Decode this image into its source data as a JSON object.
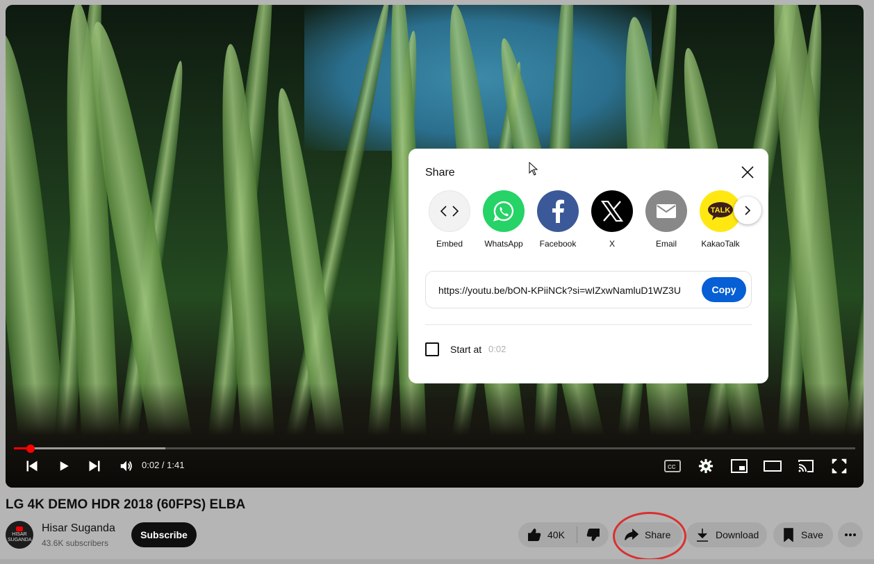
{
  "video": {
    "current_time": "0:02",
    "duration": "1:41",
    "time_display": "0:02 / 1:41",
    "progress_fraction": 0.02
  },
  "share_dialog": {
    "title": "Share",
    "targets": [
      {
        "label": "Embed",
        "icon": "embed-icon",
        "color": "#f2f2f2"
      },
      {
        "label": "WhatsApp",
        "icon": "whatsapp-icon",
        "color": "#25d366"
      },
      {
        "label": "Facebook",
        "icon": "facebook-icon",
        "color": "#3b5998"
      },
      {
        "label": "X",
        "icon": "x-icon",
        "color": "#000000"
      },
      {
        "label": "Email",
        "icon": "email-icon",
        "color": "#888888"
      },
      {
        "label": "KakaoTalk",
        "icon": "kakaotalk-icon",
        "color": "#ffe812",
        "badge": "TALK"
      }
    ],
    "url": "https://youtu.be/bON-KPiiNCk?si=wIZxwNamluD1WZ3U",
    "copy_label": "Copy",
    "start_at_label": "Start at",
    "start_at_time": "0:02",
    "start_at_checked": false
  },
  "info": {
    "title": "LG 4K DEMO HDR 2018 (60FPS) ELBA",
    "channel_name": "Hisar Suganda",
    "avatar_text": "HISAR SUGANDA",
    "subscribers": "43.6K subscribers",
    "subscribe_label": "Subscribe",
    "likes": "40K",
    "share_label": "Share",
    "download_label": "Download",
    "save_label": "Save"
  },
  "colors": {
    "accent_red": "#ff0000",
    "copy_blue": "#065fd4",
    "highlight_ring": "#d93030"
  }
}
